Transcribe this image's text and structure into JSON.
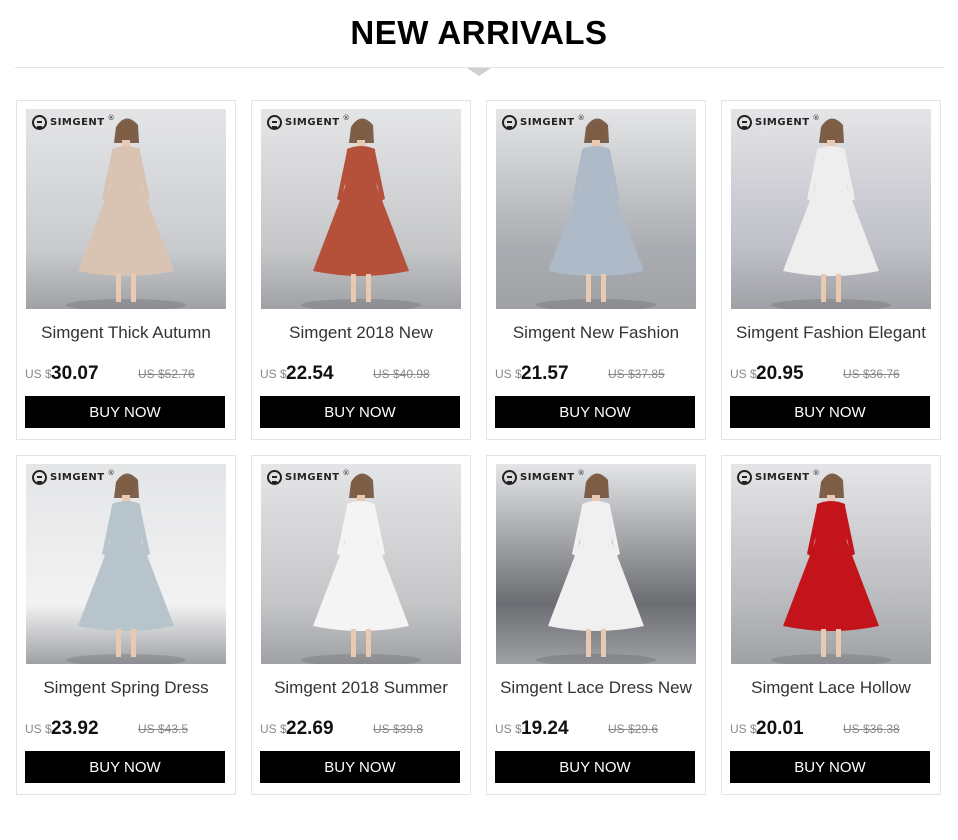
{
  "section": {
    "title": "NEW ARRIVALS"
  },
  "brand": {
    "logo_text": "SIMGENT",
    "registered": "®"
  },
  "colors": {
    "button_bg": "#000000",
    "button_text": "#ffffff",
    "price": "#111111",
    "old_price": "#888888"
  },
  "products": [
    {
      "name": "Simgent Thick Autumn",
      "currency": "US $",
      "price": "30.07",
      "old_price": "US $52.76",
      "button": "BUY NOW",
      "dress_color": "#d9c3b3",
      "bg": "#c9cbcf"
    },
    {
      "name": "Simgent 2018 New",
      "currency": "US $",
      "price": "22.54",
      "old_price": "US $40.98",
      "button": "BUY NOW",
      "dress_color": "#b5503a",
      "bg": "#c6c7c9"
    },
    {
      "name": "Simgent New Fashion",
      "currency": "US $",
      "price": "21.57",
      "old_price": "US $37.85",
      "button": "BUY NOW",
      "dress_color": "#aebac8",
      "bg": "#a9acb0"
    },
    {
      "name": "Simgent Fashion Elegant",
      "currency": "US $",
      "price": "20.95",
      "old_price": "US $36.76",
      "button": "BUY NOW",
      "dress_color": "#eeeeee",
      "bg": "#bfbfc8"
    },
    {
      "name": "Simgent Spring Dress",
      "currency": "US $",
      "price": "23.92",
      "old_price": "US $43.5",
      "button": "BUY NOW",
      "dress_color": "#b7c4cc",
      "bg": "#f2f2f2"
    },
    {
      "name": "Simgent 2018 Summer",
      "currency": "US $",
      "price": "22.69",
      "old_price": "US $39.8",
      "button": "BUY NOW",
      "dress_color": "#f4f4f4",
      "bg": "#c4c5c7"
    },
    {
      "name": "Simgent Lace Dress New",
      "currency": "US $",
      "price": "19.24",
      "old_price": "US $29.6",
      "button": "BUY NOW",
      "dress_color": "#f0f0f0",
      "bg": "#6b6d72"
    },
    {
      "name": "Simgent Lace Hollow",
      "currency": "US $",
      "price": "20.01",
      "old_price": "US $36.38",
      "button": "BUY NOW",
      "dress_color": "#c4141b",
      "bg": "#b9babd"
    }
  ]
}
